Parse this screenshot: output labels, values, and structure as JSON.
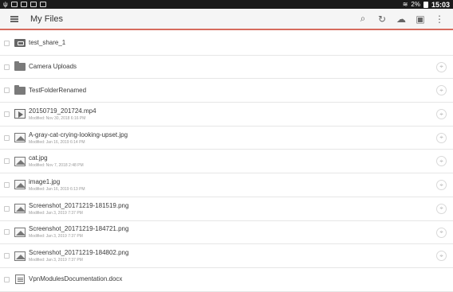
{
  "status_bar": {
    "battery": "2%",
    "time": "15:03"
  },
  "header": {
    "title": "My Files"
  },
  "rows": [
    {
      "name": "test_share_1",
      "meta": "",
      "type": "shared-folder",
      "pinned": false
    },
    {
      "name": "Camera Uploads",
      "meta": "",
      "type": "folder",
      "pinned": true
    },
    {
      "name": "TestFolderRenamed",
      "meta": "",
      "type": "folder",
      "pinned": true
    },
    {
      "name": "20150719_201724.mp4",
      "meta": "Modified: Nov 30, 2018 6:16 PM",
      "type": "video",
      "pinned": true
    },
    {
      "name": "A-gray-cat-crying-looking-upset.jpg",
      "meta": "Modified: Jan 16, 2019 6:14 PM",
      "type": "image",
      "pinned": true
    },
    {
      "name": "cat.jpg",
      "meta": "Modified: Nov 7, 2018 2:48 PM",
      "type": "image",
      "pinned": true
    },
    {
      "name": "image1.jpg",
      "meta": "Modified: Jan 16, 2019 6:13 PM",
      "type": "image",
      "pinned": true
    },
    {
      "name": "Screenshot_20171219-181519.png",
      "meta": "Modified: Jan 3, 2019 7:37 PM",
      "type": "image",
      "pinned": true
    },
    {
      "name": "Screenshot_20171219-184721.png",
      "meta": "Modified: Jan 3, 2019 7:37 PM",
      "type": "image",
      "pinned": true
    },
    {
      "name": "Screenshot_20171219-184802.png",
      "meta": "Modified: Jan 3, 2019 7:37 PM",
      "type": "image",
      "pinned": true
    },
    {
      "name": "VpnModulesDocumentation.docx",
      "meta": "",
      "type": "doc",
      "pinned": false
    }
  ],
  "icons": {
    "menu": "hamburger-icon",
    "search": "search-icon",
    "sync": "sync-icon",
    "upload": "cloud-upload-icon",
    "new_folder": "create-folder-icon",
    "more": "more-vert-icon",
    "pin": "pin-icon"
  }
}
